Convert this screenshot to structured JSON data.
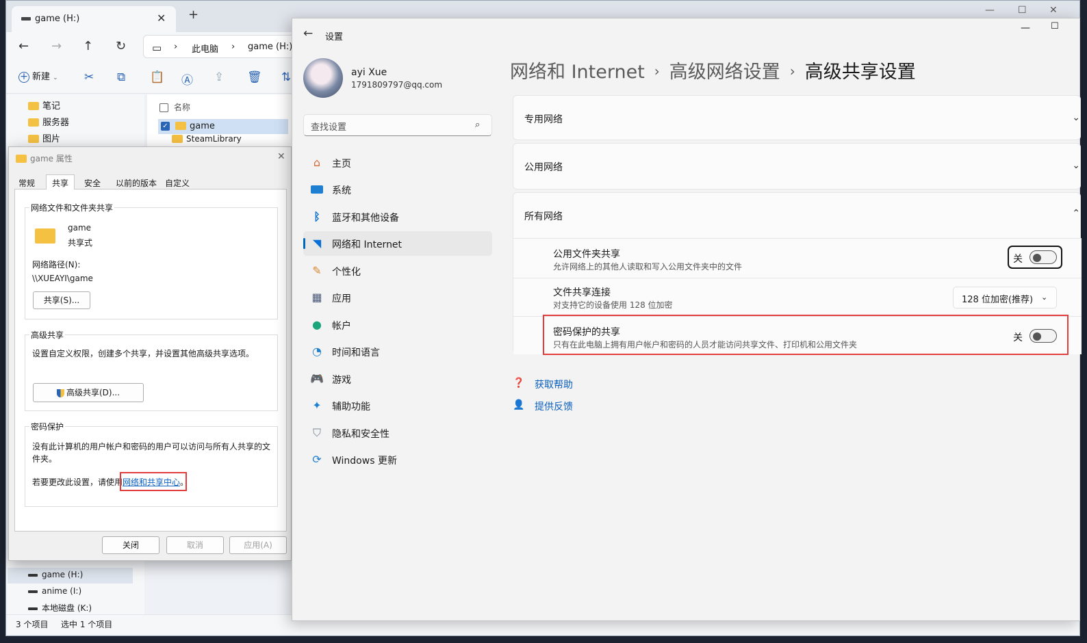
{
  "explorer": {
    "tab_title": "game (H:)",
    "breadcrumb": [
      "此电脑",
      "game (H:)"
    ],
    "new_label": "新建",
    "nav_items": [
      "笔记",
      "服务器",
      "图片"
    ],
    "drives": [
      "game (H:)",
      "anime (I:)",
      "本地磁盘 (K:)"
    ],
    "column_name": "名称",
    "files": [
      "game",
      "SteamLibrary"
    ],
    "status_count": "3 个项目",
    "status_selected": "选中 1 个项目"
  },
  "props": {
    "title": "game 属性",
    "tabs": [
      "常规",
      "共享",
      "安全",
      "以前的版本",
      "自定义"
    ],
    "group1_title": "网络文件和文件夹共享",
    "folder_name": "game",
    "share_state": "共享式",
    "path_label": "网络路径(N):",
    "path_value": "\\\\XUEAYI\\game",
    "share_button": "共享(S)...",
    "group2_title": "高级共享",
    "group2_desc": "设置自定义权限，创建多个共享，并设置其他高级共享选项。",
    "adv_button": "高级共享(D)...",
    "group3_title": "密码保护",
    "group3_desc": "没有此计算机的用户帐户和密码的用户可以访问与所有人共享的文件夹。",
    "change_prefix": "若要更改此设置，请使用",
    "change_link": "网络和共享中心",
    "change_suffix": "。",
    "btn_close": "关闭",
    "btn_cancel": "取消",
    "btn_apply": "应用(A)"
  },
  "settings": {
    "app_title": "设置",
    "user_name": "ayi Xue",
    "user_email": "1791809797@qq.com",
    "search_placeholder": "查找设置",
    "nav": [
      {
        "label": "主页",
        "icon": "home-icon"
      },
      {
        "label": "系统",
        "icon": "system-icon"
      },
      {
        "label": "蓝牙和其他设备",
        "icon": "bluetooth-icon"
      },
      {
        "label": "网络和 Internet",
        "icon": "wifi-icon"
      },
      {
        "label": "个性化",
        "icon": "brush-icon"
      },
      {
        "label": "应用",
        "icon": "apps-icon"
      },
      {
        "label": "帐户",
        "icon": "account-icon"
      },
      {
        "label": "时间和语言",
        "icon": "clock-icon"
      },
      {
        "label": "游戏",
        "icon": "gamepad-icon"
      },
      {
        "label": "辅助功能",
        "icon": "accessibility-icon"
      },
      {
        "label": "隐私和安全性",
        "icon": "shield-icon"
      },
      {
        "label": "Windows 更新",
        "icon": "update-icon"
      }
    ],
    "breadcrumb": [
      "网络和 Internet",
      "高级网络设置",
      "高级共享设置"
    ],
    "sections": {
      "private": "专用网络",
      "public": "公用网络",
      "all": "所有网络"
    },
    "rows": {
      "public_folder_title": "公用文件夹共享",
      "public_folder_desc": "允许网络上的其他人读取和写入公用文件夹中的文件",
      "public_folder_state": "关",
      "file_sharing_title": "文件共享连接",
      "file_sharing_desc": "对支持它的设备使用 128 位加密",
      "file_sharing_value": "128 位加密(推荐)",
      "password_title": "密码保护的共享",
      "password_desc": "只有在此电脑上拥有用户帐户和密码的人员才能访问共享文件、打印机和公用文件夹",
      "password_state": "关"
    },
    "help": "获取帮助",
    "feedback": "提供反馈"
  },
  "colors": {
    "accent": "#0067c0",
    "highlight_box": "#e33c3c",
    "folder": "#f5c142"
  }
}
